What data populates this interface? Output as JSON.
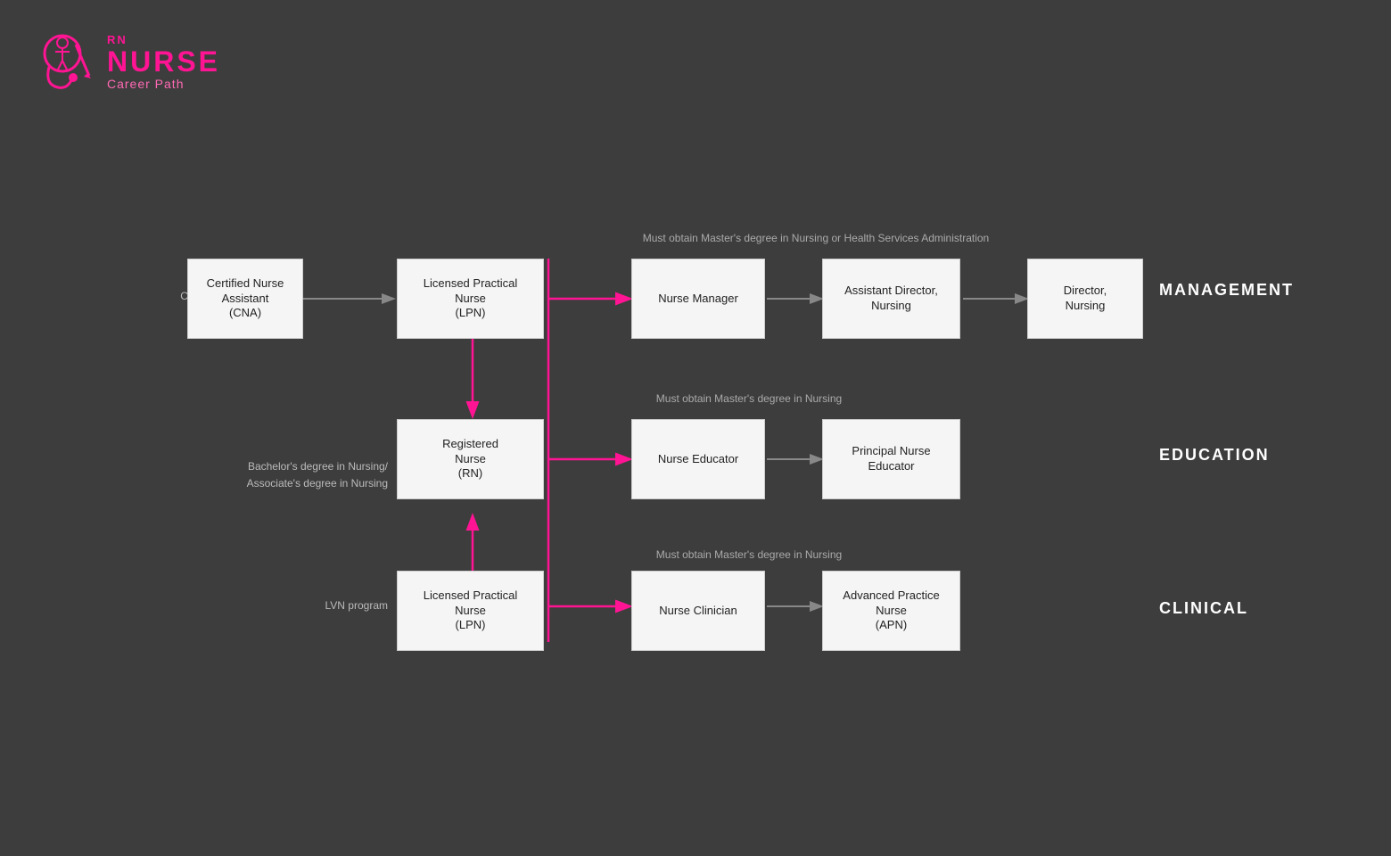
{
  "logo": {
    "rn": "RN",
    "nurse": "NURSE",
    "career": "Career Path"
  },
  "notes": {
    "management": "Must obtain Master's degree in Nursing or Health Services Administration",
    "education": "Must obtain Master's degree in Nursing",
    "clinical": "Must obtain Master's degree in Nursing"
  },
  "labels": {
    "cna_program": "CNA program",
    "bachelors": "Bachelor's degree in Nursing/\nAssociate's degree in Nursing",
    "lvn_program": "LVN program"
  },
  "sections": {
    "management": "MANAGEMENT",
    "education": "EDUCATION",
    "clinical": "CLINICAL"
  },
  "nodes": {
    "cna": "Certified Nurse\nAssistant\n(CNA)",
    "lpn_top": "Licensed Practical\nNurse\n(LPN)",
    "rn": "Registered\nNurse\n(RN)",
    "lpn_bottom": "Licensed Practical\nNurse\n(LPN)",
    "nurse_manager": "Nurse Manager",
    "asst_director": "Assistant Director,\nNursing",
    "director": "Director,\nNursing",
    "nurse_educator": "Nurse Educator",
    "principal_educator": "Principal Nurse\nEducator",
    "nurse_clinician": "Nurse Clinician",
    "apn": "Advanced Practice\nNurse\n(APN)"
  },
  "colors": {
    "accent": "#ff1493",
    "background": "#3d3d3d",
    "node_bg": "#f5f5f5",
    "text_dark": "#222222",
    "text_light": "#bbbbbb",
    "text_white": "#ffffff"
  }
}
